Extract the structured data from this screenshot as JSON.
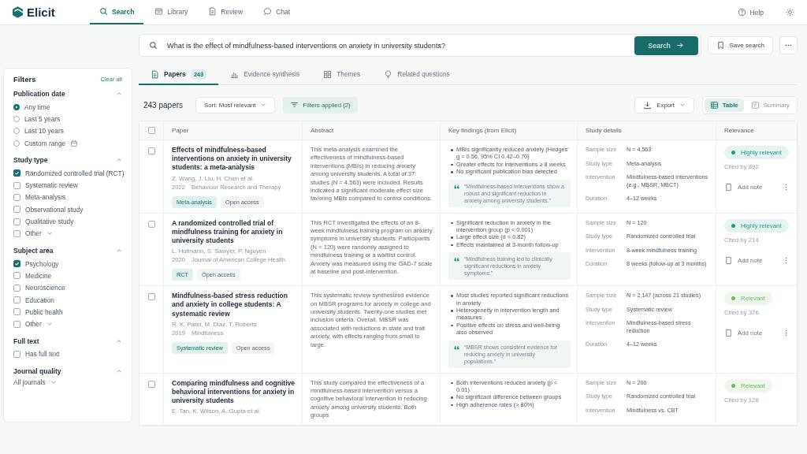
{
  "app": {
    "name": "Elicit"
  },
  "nav": [
    {
      "label": "Search",
      "selected": true
    },
    {
      "label": "Library",
      "selected": false
    },
    {
      "label": "Review",
      "selected": false
    },
    {
      "label": "Chat",
      "selected": false
    }
  ],
  "help": "Help",
  "search": {
    "value": "What is the effect of mindfulness-based interventions on anxiety in university students?",
    "button": "Search"
  },
  "save_search": "Save search",
  "tabs": [
    {
      "label": "Papers",
      "count": "243",
      "selected": true
    },
    {
      "label": "Evidence synthesis",
      "selected": false
    },
    {
      "label": "Themes",
      "selected": false
    },
    {
      "label": "Related questions",
      "selected": false
    }
  ],
  "filters": {
    "title": "Filters",
    "clear": "Clear all",
    "sections": [
      {
        "title": "Publication date",
        "expanded": true,
        "kind": "radio",
        "options": [
          {
            "label": "Any time",
            "selected": true
          },
          {
            "label": "Last 5 years",
            "selected": false
          },
          {
            "label": "Last 10 years",
            "selected": false
          },
          {
            "label": "Custom range",
            "selected": false,
            "date_picker": true
          }
        ]
      },
      {
        "title": "Study type",
        "expanded": true,
        "kind": "checkbox",
        "options": [
          {
            "label": "Randomized controlled trial (RCT)",
            "checked": true
          },
          {
            "label": "Systematic review",
            "checked": false
          },
          {
            "label": "Meta-analysis",
            "checked": false
          },
          {
            "label": "Observational study",
            "checked": false
          },
          {
            "label": "Qualitative study",
            "checked": false
          },
          {
            "label": "Other",
            "checked": false,
            "expandable": true
          }
        ]
      },
      {
        "title": "Subject area",
        "expanded": true,
        "kind": "checkbox",
        "options": [
          {
            "label": "Psychology",
            "checked": true
          },
          {
            "label": "Medicine",
            "checked": false
          },
          {
            "label": "Neuroscience",
            "checked": false
          },
          {
            "label": "Education",
            "checked": false
          },
          {
            "label": "Public health",
            "checked": false
          },
          {
            "label": "Other",
            "checked": false,
            "expandable": true
          }
        ]
      },
      {
        "title": "Full text",
        "expanded": true,
        "kind": "checkbox",
        "options": [
          {
            "label": "Has full text",
            "checked": false
          }
        ]
      },
      {
        "title": "Journal quality",
        "expanded": true,
        "kind": "dropdown",
        "value": "All journals"
      }
    ]
  },
  "results": {
    "count": "243 papers",
    "sort": "Sort: Most relevant",
    "filters_applied": "Filters applied (2)",
    "export": "Export",
    "views": [
      {
        "label": "Table",
        "selected": true
      },
      {
        "label": "Summary",
        "selected": false
      }
    ]
  },
  "table": {
    "select_all": {
      "checked": false
    },
    "columns": [
      "Paper",
      "Abstract",
      "Key findings (from Elicit)",
      "Study details",
      "Relevance"
    ],
    "rows": [
      {
        "selected": false,
        "title": "Effects of mindfulness-based interventions on anxiety in university students: a meta-analysis",
        "authors": "Z. Wang, J. Liu, H. Chen et al.",
        "year": "2022",
        "journal": "Behaviour Research and Therapy",
        "tags": [
          {
            "label": "Meta-analysis",
            "kind": "type"
          },
          {
            "label": "Open access",
            "kind": "access"
          }
        ],
        "abstract": "This meta-analysis examined the effectiveness of mindfulness-based interventions (MBIs) in reducing anxiety among university students. A total of 37 studies (N = 4,563) were included. Results indicated a significant moderate effect size favoring MBIs compared to control conditions.",
        "findings": [
          "MBIs significantly reduced anxiety (Hedges’ g = 0.56, 95% CI 0.42–0.70)",
          "Greater effects for interventions ≥ 8 weeks",
          "No significant publication bias detected"
        ],
        "quote": "“Mindfulness-based interventions show a robust and significant reduction in anxiety among university students.”",
        "details": [
          {
            "label": "Sample size",
            "value": "N = 4,563"
          },
          {
            "label": "Study type",
            "value": "Meta-analysis"
          },
          {
            "label": "Intervention",
            "value": "Mindfulness-based interventions (e.g., MBSR, MBCT)"
          },
          {
            "label": "Duration",
            "value": "4–12 weeks"
          }
        ],
        "relevance": {
          "label": "Highly relevant",
          "color": "#1f9a80"
        },
        "cited": "Cited by 892",
        "note": "Add note"
      },
      {
        "selected": false,
        "title": "A randomized controlled trial of mindfulness training for anxiety in university students",
        "authors": "L. Hofmann, S. Sawyer, P. Nguyen",
        "year": "2020",
        "journal": "Journal of American College Health",
        "tags": [
          {
            "label": "RCT",
            "kind": "type"
          },
          {
            "label": "Open access",
            "kind": "access"
          }
        ],
        "abstract": "This RCT investigated the effects of an 8-week mindfulness training program on anxiety symptoms in university students. Participants (N = 120) were randomly assigned to mindfulness training or a waitlist control. Anxiety was measured using the GAD-7 scale at baseline and post-intervention.",
        "findings": [
          "Significant reduction in anxiety in the intervention group (p < 0.001)",
          "Large effect size (d = 0.82)",
          "Effects maintained at 3-month follow-up"
        ],
        "quote": "“Mindfulness training led to clinically significant reductions in anxiety symptoms.”",
        "details": [
          {
            "label": "Sample size",
            "value": "N = 120"
          },
          {
            "label": "Study type",
            "value": "Randomized controlled trial"
          },
          {
            "label": "Intervention",
            "value": "8-week mindfulness training"
          },
          {
            "label": "Duration",
            "value": "8 weeks (follow-up at 3 months)"
          }
        ],
        "relevance": {
          "label": "Highly relevant",
          "color": "#1f9a80"
        },
        "cited": "Cited by 214",
        "note": "Add note"
      },
      {
        "selected": false,
        "title": "Mindfulness-based stress reduction and anxiety in college students: A systematic review",
        "authors": "R. K. Patel, M. Diaz, T. Roberts",
        "year": "2019",
        "journal": "Mindfulness",
        "tags": [
          {
            "label": "Systematic review",
            "kind": "type"
          },
          {
            "label": "Open access",
            "kind": "access"
          }
        ],
        "abstract": "This systematic review synthesized evidence on MBSR programs for anxiety in college and university students. Twenty-one studies met inclusion criteria. Overall, MBSR was associated with reductions in state and trait anxiety, with effects ranging from small to large.",
        "findings": [
          "Most studies reported significant reductions in anxiety",
          "Heterogeneity in intervention length and measures",
          "Positive effects on stress and well-being also observed"
        ],
        "quote": "“MBSR shows consistent evidence for reducing anxiety in university populations.”",
        "details": [
          {
            "label": "Sample size",
            "value": "N = 2,147 (across 21 studies)"
          },
          {
            "label": "Study type",
            "value": "Systematic review"
          },
          {
            "label": "Intervention",
            "value": "Mindfulness-based stress reduction"
          },
          {
            "label": "Duration",
            "value": "4–12 weeks"
          }
        ],
        "relevance": {
          "label": "Relevant",
          "color": "#6cba5c"
        },
        "cited": "Cited by 376",
        "note": "Add note"
      },
      {
        "selected": false,
        "title": "Comparing mindfulness and cognitive behavioral interventions for anxiety in university students",
        "authors": "E. Tan, K. Wilson, A. Gupta et al.",
        "abstract": "This study compared the effectiveness of a mindfulness-based intervention versus a cognitive behavioral intervention in reducing anxiety among university students. Both groups",
        "findings": [
          "Both interventions reduced anxiety (p < 0.01)",
          "No significant difference between groups",
          "High adherence rates (> 80%)"
        ],
        "details": [
          {
            "label": "Sample size",
            "value": "N = 200"
          },
          {
            "label": "Study type",
            "value": "Randomized controlled trial"
          },
          {
            "label": "Intervention",
            "value": "Mindfulness vs. CBT"
          }
        ],
        "relevance": {
          "label": "Relevant",
          "color": "#6cba5c"
        },
        "cited": "Cited by 128"
      }
    ]
  }
}
